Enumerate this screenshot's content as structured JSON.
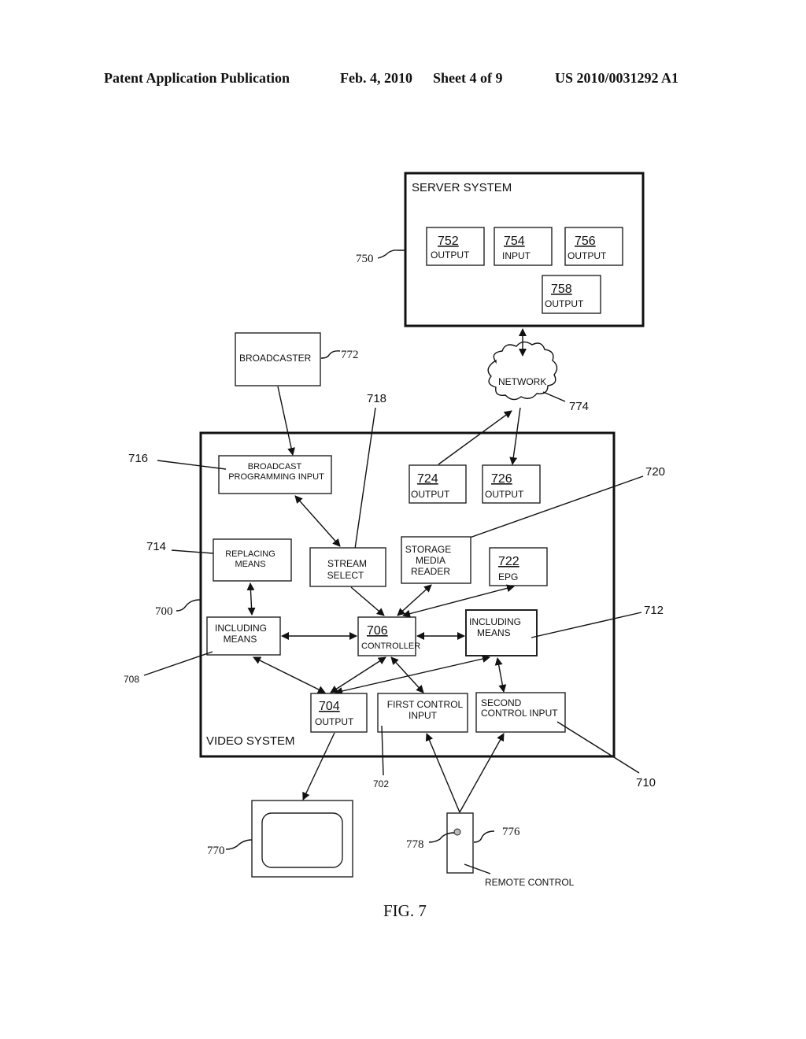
{
  "header": {
    "publication": "Patent Application Publication",
    "date": "Feb. 4, 2010",
    "sheet": "Sheet 4 of 9",
    "number": "US 2010/0031292 A1"
  },
  "figure_label": "FIG. 7",
  "server_system": {
    "title": "SERVER SYSTEM",
    "ref": "750",
    "blocks": [
      {
        "num": "752",
        "label": "OUTPUT"
      },
      {
        "num": "754",
        "label": "INPUT"
      },
      {
        "num": "756",
        "label": "OUTPUT"
      },
      {
        "num": "758",
        "label": "OUTPUT"
      }
    ]
  },
  "broadcaster": {
    "label": "BROADCASTER",
    "ref": "772"
  },
  "network": {
    "label": "NETWORK",
    "ref": "774"
  },
  "video_system": {
    "title": "VIDEO SYSTEM",
    "ref": "700",
    "broadcast_input": {
      "line1": "BROADCAST",
      "line2": "PROGRAMMING INPUT",
      "ref": "716"
    },
    "stream_select": {
      "line1": "STREAM",
      "line2": "SELECT",
      "ref": "718"
    },
    "output_724": {
      "num": "724",
      "label": "OUTPUT"
    },
    "output_726": {
      "num": "726",
      "label": "OUTPUT"
    },
    "storage_reader": {
      "line1": "STORAGE",
      "line2": "MEDIA",
      "line3": "READER",
      "ref": "720"
    },
    "epg": {
      "num": "722",
      "label": "EPG"
    },
    "replacing_means": {
      "line1": "REPLACING",
      "line2": "MEANS",
      "ref": "714"
    },
    "including_means_left": {
      "line1": "INCLUDING",
      "line2": "MEANS",
      "ref": "708"
    },
    "controller": {
      "num": "706",
      "label": "CONTROLLER"
    },
    "including_means_right": {
      "line1": "INCLUDING",
      "line2": "MEANS",
      "ref": "712"
    },
    "output_704": {
      "num": "704",
      "label": "OUTPUT"
    },
    "first_control": {
      "line1": "FIRST CONTROL",
      "line2": "INPUT",
      "ref": "702"
    },
    "second_control": {
      "line1": "SECOND",
      "line2": "CONTROL INPUT",
      "ref": "710"
    }
  },
  "display": {
    "ref": "770"
  },
  "remote": {
    "label": "REMOTE CONTROL",
    "ref": "776",
    "button_ref": "778"
  }
}
